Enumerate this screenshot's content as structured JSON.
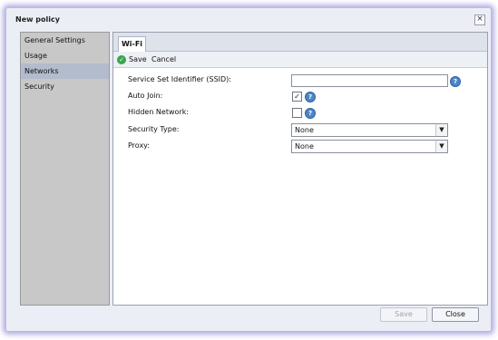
{
  "window": {
    "title": "New policy",
    "close_glyph": "×"
  },
  "sidebar": {
    "items": [
      {
        "label": "General Settings"
      },
      {
        "label": "Usage"
      },
      {
        "label": "Networks",
        "selected": true
      },
      {
        "label": "Security"
      }
    ]
  },
  "tabs": [
    {
      "label": "Wi-Fi",
      "active": true
    }
  ],
  "toolbar": {
    "save_label": "Save",
    "cancel_label": "Cancel",
    "save_icon": "check-circle-icon"
  },
  "form": {
    "ssid": {
      "label": "Service Set Identifier (SSID):",
      "value": ""
    },
    "auto_join": {
      "label": "Auto Join:",
      "checked": true,
      "check_glyph": "✓"
    },
    "hidden_network": {
      "label": "Hidden Network:",
      "checked": false
    },
    "security_type": {
      "label": "Security Type:",
      "value": "None"
    },
    "proxy": {
      "label": "Proxy:",
      "value": "None"
    },
    "help_glyph": "?",
    "dropdown_glyph": "▼"
  },
  "footer": {
    "save_label": "Save",
    "save_disabled": true,
    "close_label": "Close"
  },
  "colors": {
    "accent": "#4c86c6",
    "save_icon": "#39a54a",
    "selected_nav": "#b3bccc"
  }
}
